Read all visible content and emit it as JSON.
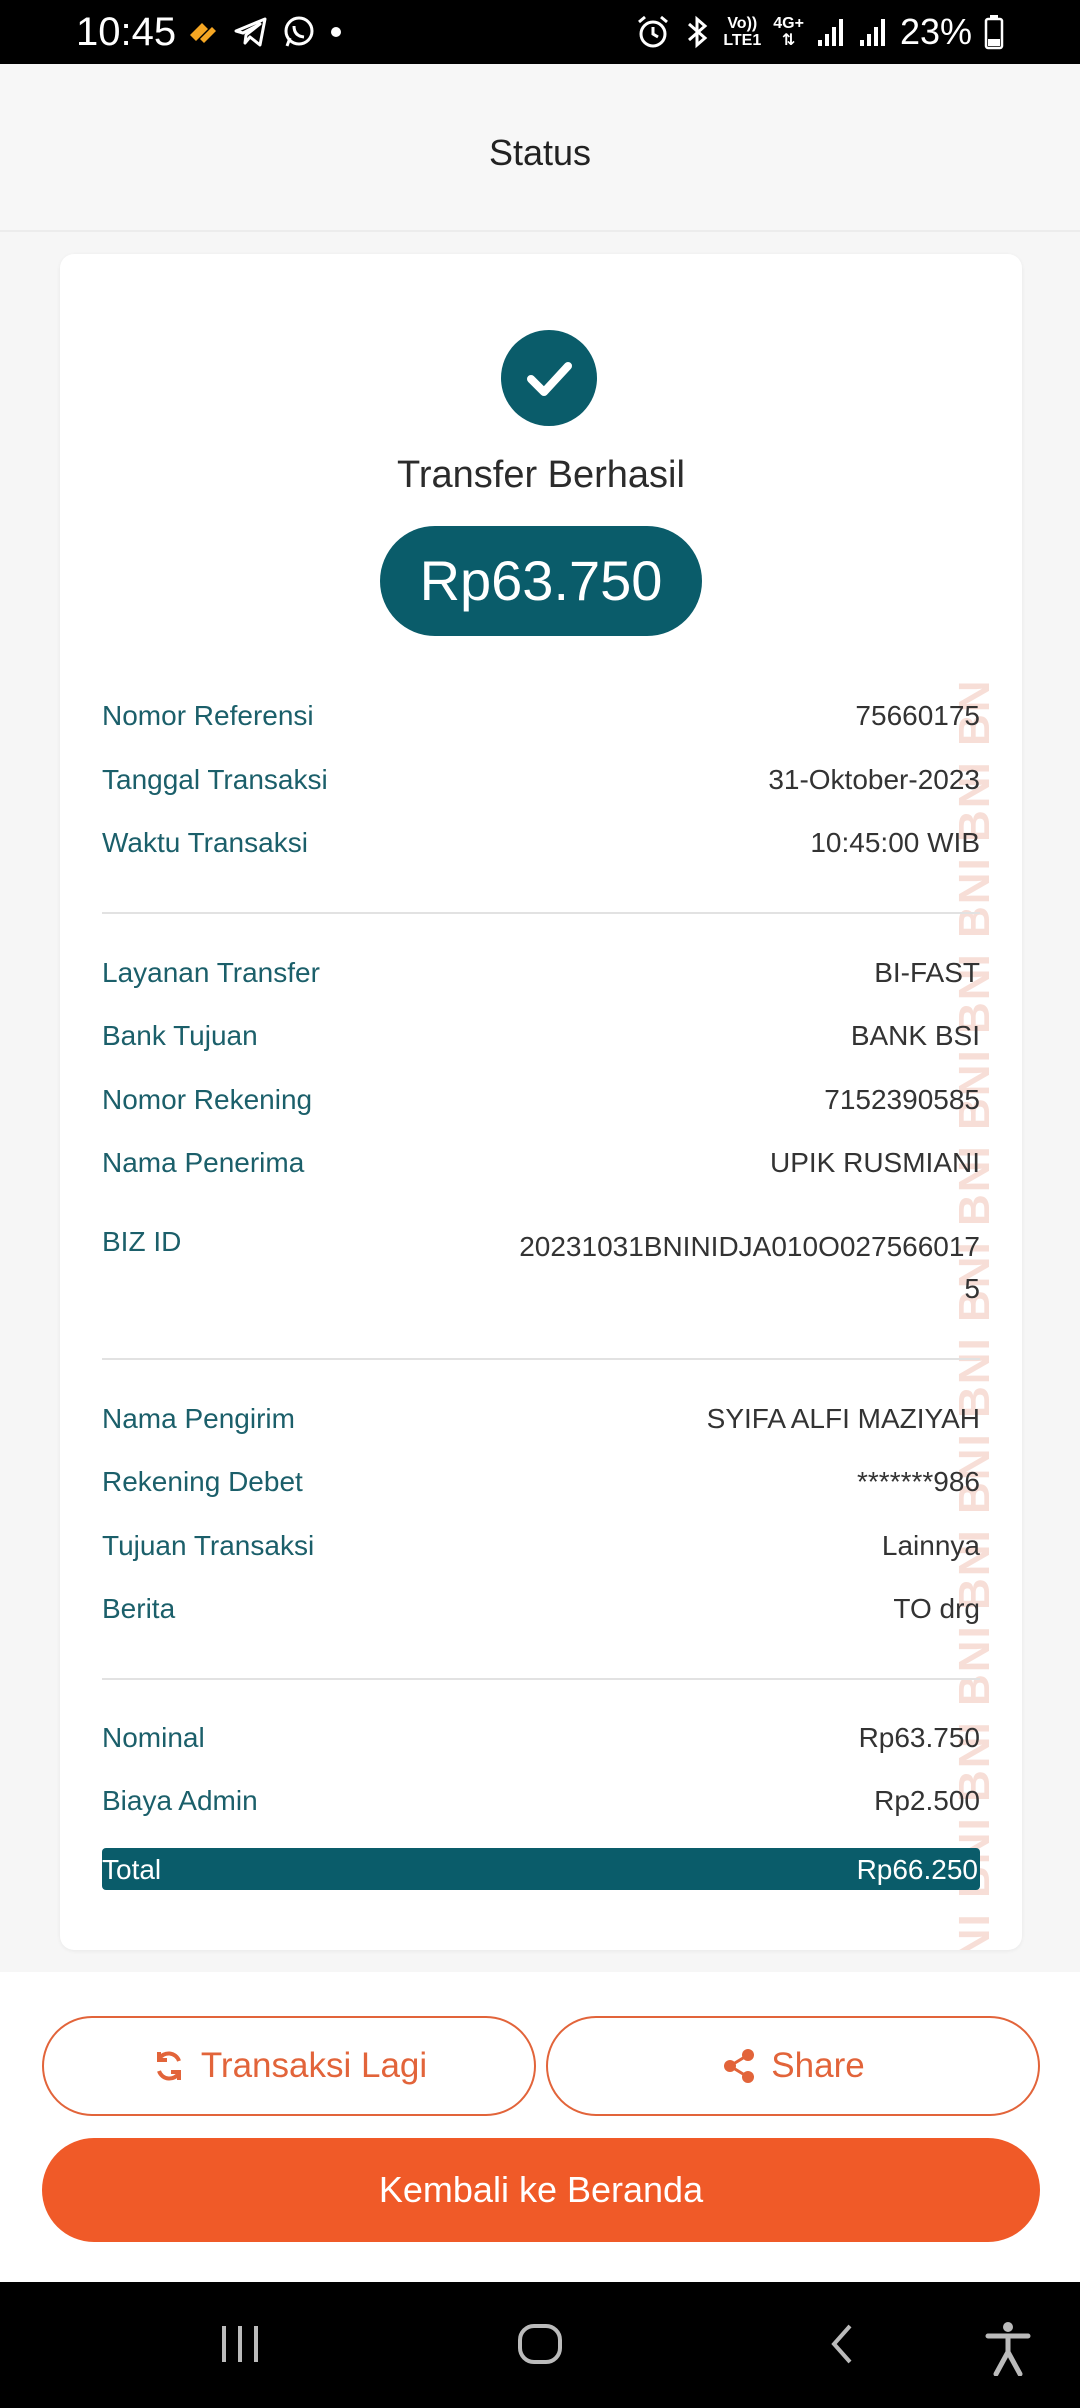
{
  "status_bar": {
    "time": "10:45",
    "network": {
      "top": "Vo))",
      "bottom": "LTE1"
    },
    "data_type": "4G+",
    "battery": "23%"
  },
  "header": {
    "title": "Status"
  },
  "card": {
    "watermark": "BNI BNI BNI BNI BNI BNI BNI BNI BNI BNI BNI BNI BNI BN",
    "title": "Transfer Berhasil",
    "amount": "Rp63.750",
    "rows": [
      {
        "label": "Nomor Referensi",
        "value": "75660175"
      },
      {
        "label": "Tanggal Transaksi",
        "value": "31-Oktober-2023"
      },
      {
        "label": "Waktu Transaksi",
        "value": "10:45:00 WIB"
      },
      {
        "label": "Layanan Transfer",
        "value": "BI-FAST"
      },
      {
        "label": "Bank Tujuan",
        "value": "BANK BSI"
      },
      {
        "label": "Nomor Rekening",
        "value": "7152390585"
      },
      {
        "label": "Nama Penerima",
        "value": "UPIK RUSMIANI"
      },
      {
        "label": "BIZ ID",
        "value": "20231031BNINIDJA010O0275660175"
      },
      {
        "label": "Nama Pengirim",
        "value": "SYIFA ALFI MAZIYAH"
      },
      {
        "label": "Rekening Debet",
        "value": "*******986"
      },
      {
        "label": "Tujuan Transaksi",
        "value": "Lainnya"
      },
      {
        "label": "Berita",
        "value": "TO drg"
      },
      {
        "label": "Nominal",
        "value": "Rp63.750"
      },
      {
        "label": "Biaya Admin",
        "value": "Rp2.500"
      }
    ],
    "total": {
      "label": "Total",
      "value": "Rp66.250"
    }
  },
  "actions": {
    "repeat_label": "Transaksi Lagi",
    "share_label": "Share",
    "home_label": "Kembali ke Beranda"
  },
  "colors": {
    "primary_teal": "#0a5c6a",
    "accent_orange": "#f05a28"
  }
}
